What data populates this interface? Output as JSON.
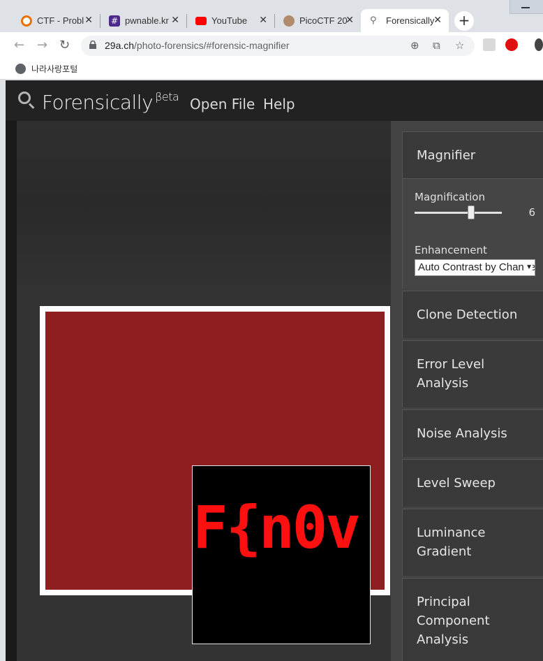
{
  "browser": {
    "tabs": [
      {
        "label": "CTF - Probl",
        "favicon_color": "#e8710a"
      },
      {
        "label": "pwnable.kr",
        "favicon_color": "#4b2a8c"
      },
      {
        "label": "YouTube",
        "favicon_color": "#ff0000"
      },
      {
        "label": "PicoCTF 20",
        "favicon_color": "#b08a6a"
      },
      {
        "label": "Forensically",
        "favicon_color": "#777777"
      }
    ],
    "url_host": "29a.ch",
    "url_path": "/photo-forensics/#forensic-magnifier",
    "bookmark": "나라사랑포털"
  },
  "app": {
    "brand": "Forensically",
    "brand_sup": "βeta",
    "nav": [
      "Open File",
      "Help"
    ]
  },
  "magnifier": {
    "title": "Magnifier",
    "magnification_label": "Magnification",
    "magnification_value": "6",
    "magnification_level": 6,
    "enhancement_label": "Enhancement",
    "enhancement_value": "Auto Contrast by Channel"
  },
  "loupe_text": "F{n0v",
  "tools": [
    "Clone Detection",
    "Error Level Analysis",
    "Noise Analysis",
    "Level Sweep",
    "Luminance Gradient",
    "Principal Component Analysis"
  ],
  "colors": {
    "photo": "#8e1e1f",
    "loupe_text": "#ff1010",
    "panel": "#3a3a3a"
  }
}
